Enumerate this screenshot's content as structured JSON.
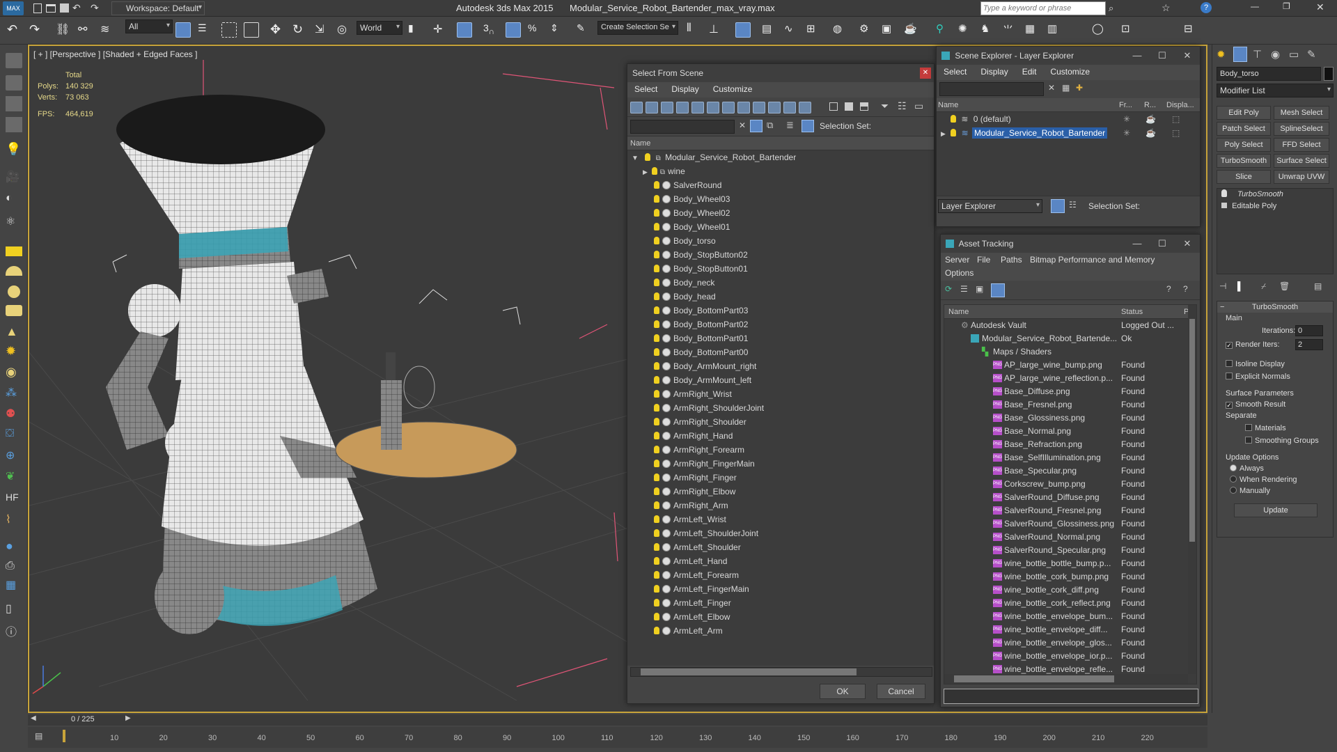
{
  "app": {
    "title": "Autodesk 3ds Max  2015",
    "file": "Modular_Service_Robot_Bartender_max_vray.max",
    "workspace": "Workspace: Default",
    "search_placeholder": "Type a keyword or phrase"
  },
  "toolbar": {
    "selection_filter": "All",
    "ref_coord": "World",
    "named_selection": "Create Selection Se"
  },
  "viewport": {
    "label": "[ + ] [Perspective ] [Shaded + Edged Faces ]",
    "stats": {
      "total_label": "Total",
      "polys_label": "Polys:",
      "polys": "140 329",
      "verts_label": "Verts:",
      "verts": "73 063",
      "fps_label": "FPS:",
      "fps": "464,619"
    }
  },
  "select_from_scene": {
    "title": "Select From Scene",
    "menu": [
      "Select",
      "Display",
      "Customize"
    ],
    "selection_set_label": "Selection Set:",
    "column_name": "Name",
    "root": "Modular_Service_Robot_Bartender",
    "items": [
      "wine",
      "SalverRound",
      "Body_Wheel03",
      "Body_Wheel02",
      "Body_Wheel01",
      "Body_torso",
      "Body_StopButton02",
      "Body_StopButton01",
      "Body_neck",
      "Body_head",
      "Body_BottomPart03",
      "Body_BottomPart02",
      "Body_BottomPart01",
      "Body_BottomPart00",
      "Body_ArmMount_right",
      "Body_ArmMount_left",
      "ArmRight_Wrist",
      "ArmRight_ShoulderJoint",
      "ArmRight_Shoulder",
      "ArmRight_Hand",
      "ArmRight_Forearm",
      "ArmRight_FingerMain",
      "ArmRight_Finger",
      "ArmRight_Elbow",
      "ArmRight_Arm",
      "ArmLeft_Wrist",
      "ArmLeft_ShoulderJoint",
      "ArmLeft_Shoulder",
      "ArmLeft_Hand",
      "ArmLeft_Forearm",
      "ArmLeft_FingerMain",
      "ArmLeft_Finger",
      "ArmLeft_Elbow",
      "ArmLeft_Arm"
    ],
    "ok": "OK",
    "cancel": "Cancel"
  },
  "scene_explorer": {
    "title": "Scene Explorer - Layer Explorer",
    "menu": [
      "Select",
      "Display",
      "Edit",
      "Customize"
    ],
    "columns": [
      "Name",
      "Fr...",
      "R...",
      "Displa..."
    ],
    "layers": [
      "0 (default)",
      "Modular_Service_Robot_Bartender"
    ],
    "footer_dropdown": "Layer Explorer",
    "selection_set_label": "Selection Set:"
  },
  "asset_tracking": {
    "title": "Asset Tracking",
    "menu": [
      "Server",
      "File",
      "Paths",
      "Bitmap Performance and Memory"
    ],
    "menu2": "Options",
    "columns": [
      "Name",
      "Status",
      "P"
    ],
    "vault": {
      "name": "Autodesk Vault",
      "status": "Logged Out ..."
    },
    "scene_file": {
      "name": "Modular_Service_Robot_Bartende...",
      "status": "Ok"
    },
    "maps_group": "Maps / Shaders",
    "maps": [
      {
        "name": "AP_large_wine_bump.png",
        "status": "Found"
      },
      {
        "name": "AP_large_wine_reflection.p...",
        "status": "Found"
      },
      {
        "name": "Base_Diffuse.png",
        "status": "Found"
      },
      {
        "name": "Base_Fresnel.png",
        "status": "Found"
      },
      {
        "name": "Base_Glossiness.png",
        "status": "Found"
      },
      {
        "name": "Base_Normal.png",
        "status": "Found"
      },
      {
        "name": "Base_Refraction.png",
        "status": "Found"
      },
      {
        "name": "Base_SelfIllumination.png",
        "status": "Found"
      },
      {
        "name": "Base_Specular.png",
        "status": "Found"
      },
      {
        "name": "Corkscrew_bump.png",
        "status": "Found"
      },
      {
        "name": "SalverRound_Diffuse.png",
        "status": "Found"
      },
      {
        "name": "SalverRound_Fresnel.png",
        "status": "Found"
      },
      {
        "name": "SalverRound_Glossiness.png",
        "status": "Found"
      },
      {
        "name": "SalverRound_Normal.png",
        "status": "Found"
      },
      {
        "name": "SalverRound_Specular.png",
        "status": "Found"
      },
      {
        "name": "wine_bottle_bottle_bump.p...",
        "status": "Found"
      },
      {
        "name": "wine_bottle_cork_bump.png",
        "status": "Found"
      },
      {
        "name": "wine_bottle_cork_diff.png",
        "status": "Found"
      },
      {
        "name": "wine_bottle_cork_reflect.png",
        "status": "Found"
      },
      {
        "name": "wine_bottle_envelope_bum...",
        "status": "Found"
      },
      {
        "name": "wine_bottle_envelope_diff...",
        "status": "Found"
      },
      {
        "name": "wine_bottle_envelope_glos...",
        "status": "Found"
      },
      {
        "name": "wine_bottle_envelope_ior.p...",
        "status": "Found"
      },
      {
        "name": "wine_bottle_envelope_refle...",
        "status": "Found"
      }
    ]
  },
  "command_panel": {
    "object_name": "Body_torso",
    "modifier_list": "Modifier List",
    "mod_buttons": [
      "Edit Poly",
      "Mesh Select",
      "Patch Select",
      "SplineSelect",
      "Poly Select",
      "FFD Select",
      "TurboSmooth",
      "Surface Select",
      "Slice",
      "Unwrap UVW"
    ],
    "stack": [
      "TurboSmooth",
      "Editable Poly"
    ],
    "rollout_title": "TurboSmooth",
    "main_label": "Main",
    "iterations_label": "Iterations:",
    "iterations": "0",
    "render_iters_label": "Render Iters:",
    "render_iters": "2",
    "isoline": "Isoline Display",
    "explicit_normals": "Explicit Normals",
    "surface_params": "Surface Parameters",
    "smooth_result": "Smooth Result",
    "separate": "Separate",
    "materials": "Materials",
    "smoothing_groups": "Smoothing Groups",
    "update_options": "Update Options",
    "always": "Always",
    "when_rendering": "When Rendering",
    "manually": "Manually",
    "update_button": "Update"
  },
  "timeline": {
    "frame": "0 / 225",
    "ticks": [
      "10",
      "20",
      "30",
      "40",
      "50",
      "60",
      "70",
      "80",
      "90",
      "100",
      "110",
      "120",
      "130",
      "140",
      "150",
      "160",
      "170",
      "180",
      "190",
      "200",
      "210",
      "220"
    ]
  },
  "colors": {
    "accent_selected": "#2a5fa8",
    "viewport_border": "#c8a43a",
    "robot_teal": "#3aa6b8",
    "stats_text": "#e6d98a"
  }
}
